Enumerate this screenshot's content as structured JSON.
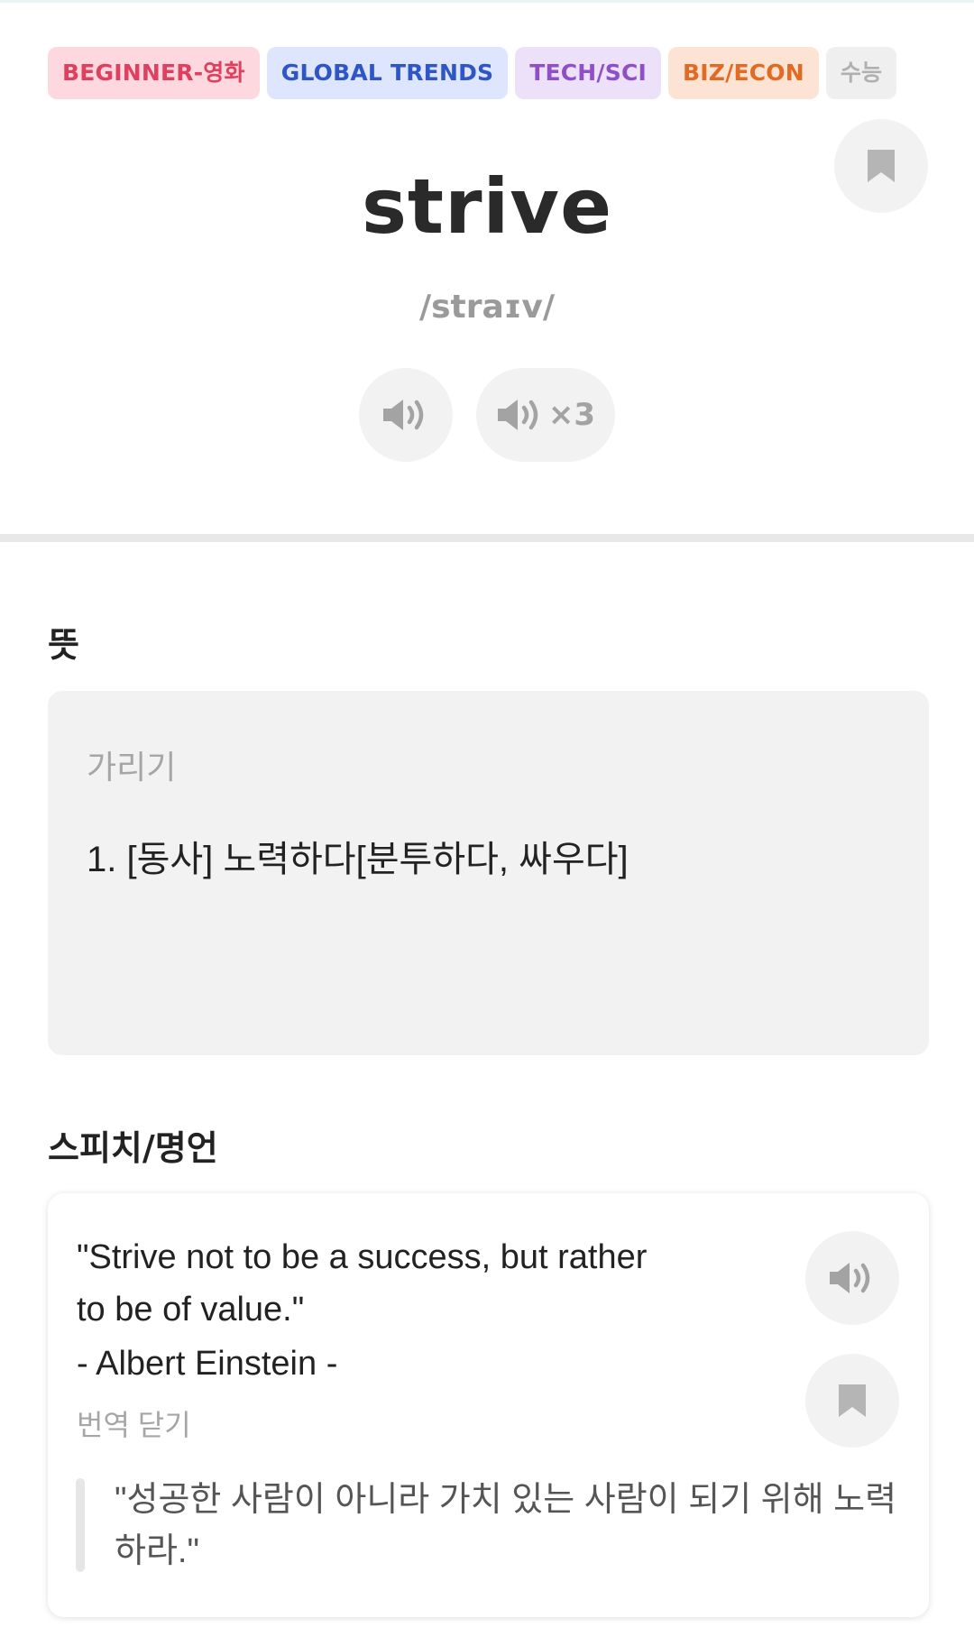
{
  "tags": [
    {
      "label": "BEGINNER-영화",
      "bg": "#fdd9df",
      "color": "#e0405f"
    },
    {
      "label": "GLOBAL TRENDS",
      "bg": "#dde6fc",
      "color": "#2f55c7"
    },
    {
      "label": "TECH/SCI",
      "bg": "#ece1f8",
      "color": "#8e4fc7"
    },
    {
      "label": "BIZ/ECON",
      "bg": "#fde3d4",
      "color": "#e36a23"
    },
    {
      "label": "수능",
      "bg": "#efefef",
      "color": "#b0b0b0"
    }
  ],
  "word": "strive",
  "phonetic": "/straɪv/",
  "audio": {
    "repeat_label": "×3"
  },
  "meaning": {
    "title": "뜻",
    "hide_label": "가리기",
    "definition": "1. [동사] 노력하다[분투하다, 싸우다]"
  },
  "speech": {
    "title": "스피치/명언",
    "quote": "\"Strive not to be a success, but rather to be of value.\"",
    "author": "- Albert Einstein -",
    "close_translation": "번역 닫기",
    "translation": "\"성공한 사람이 아니라 가치 있는 사람이 되기 위해 노력하라.\""
  },
  "colors": {
    "icon_gray": "#a3a3a3",
    "button_bg": "#f2f2f2",
    "divider": "#e8e8e8"
  },
  "icons": [
    "bookmark-icon",
    "speaker-icon"
  ]
}
